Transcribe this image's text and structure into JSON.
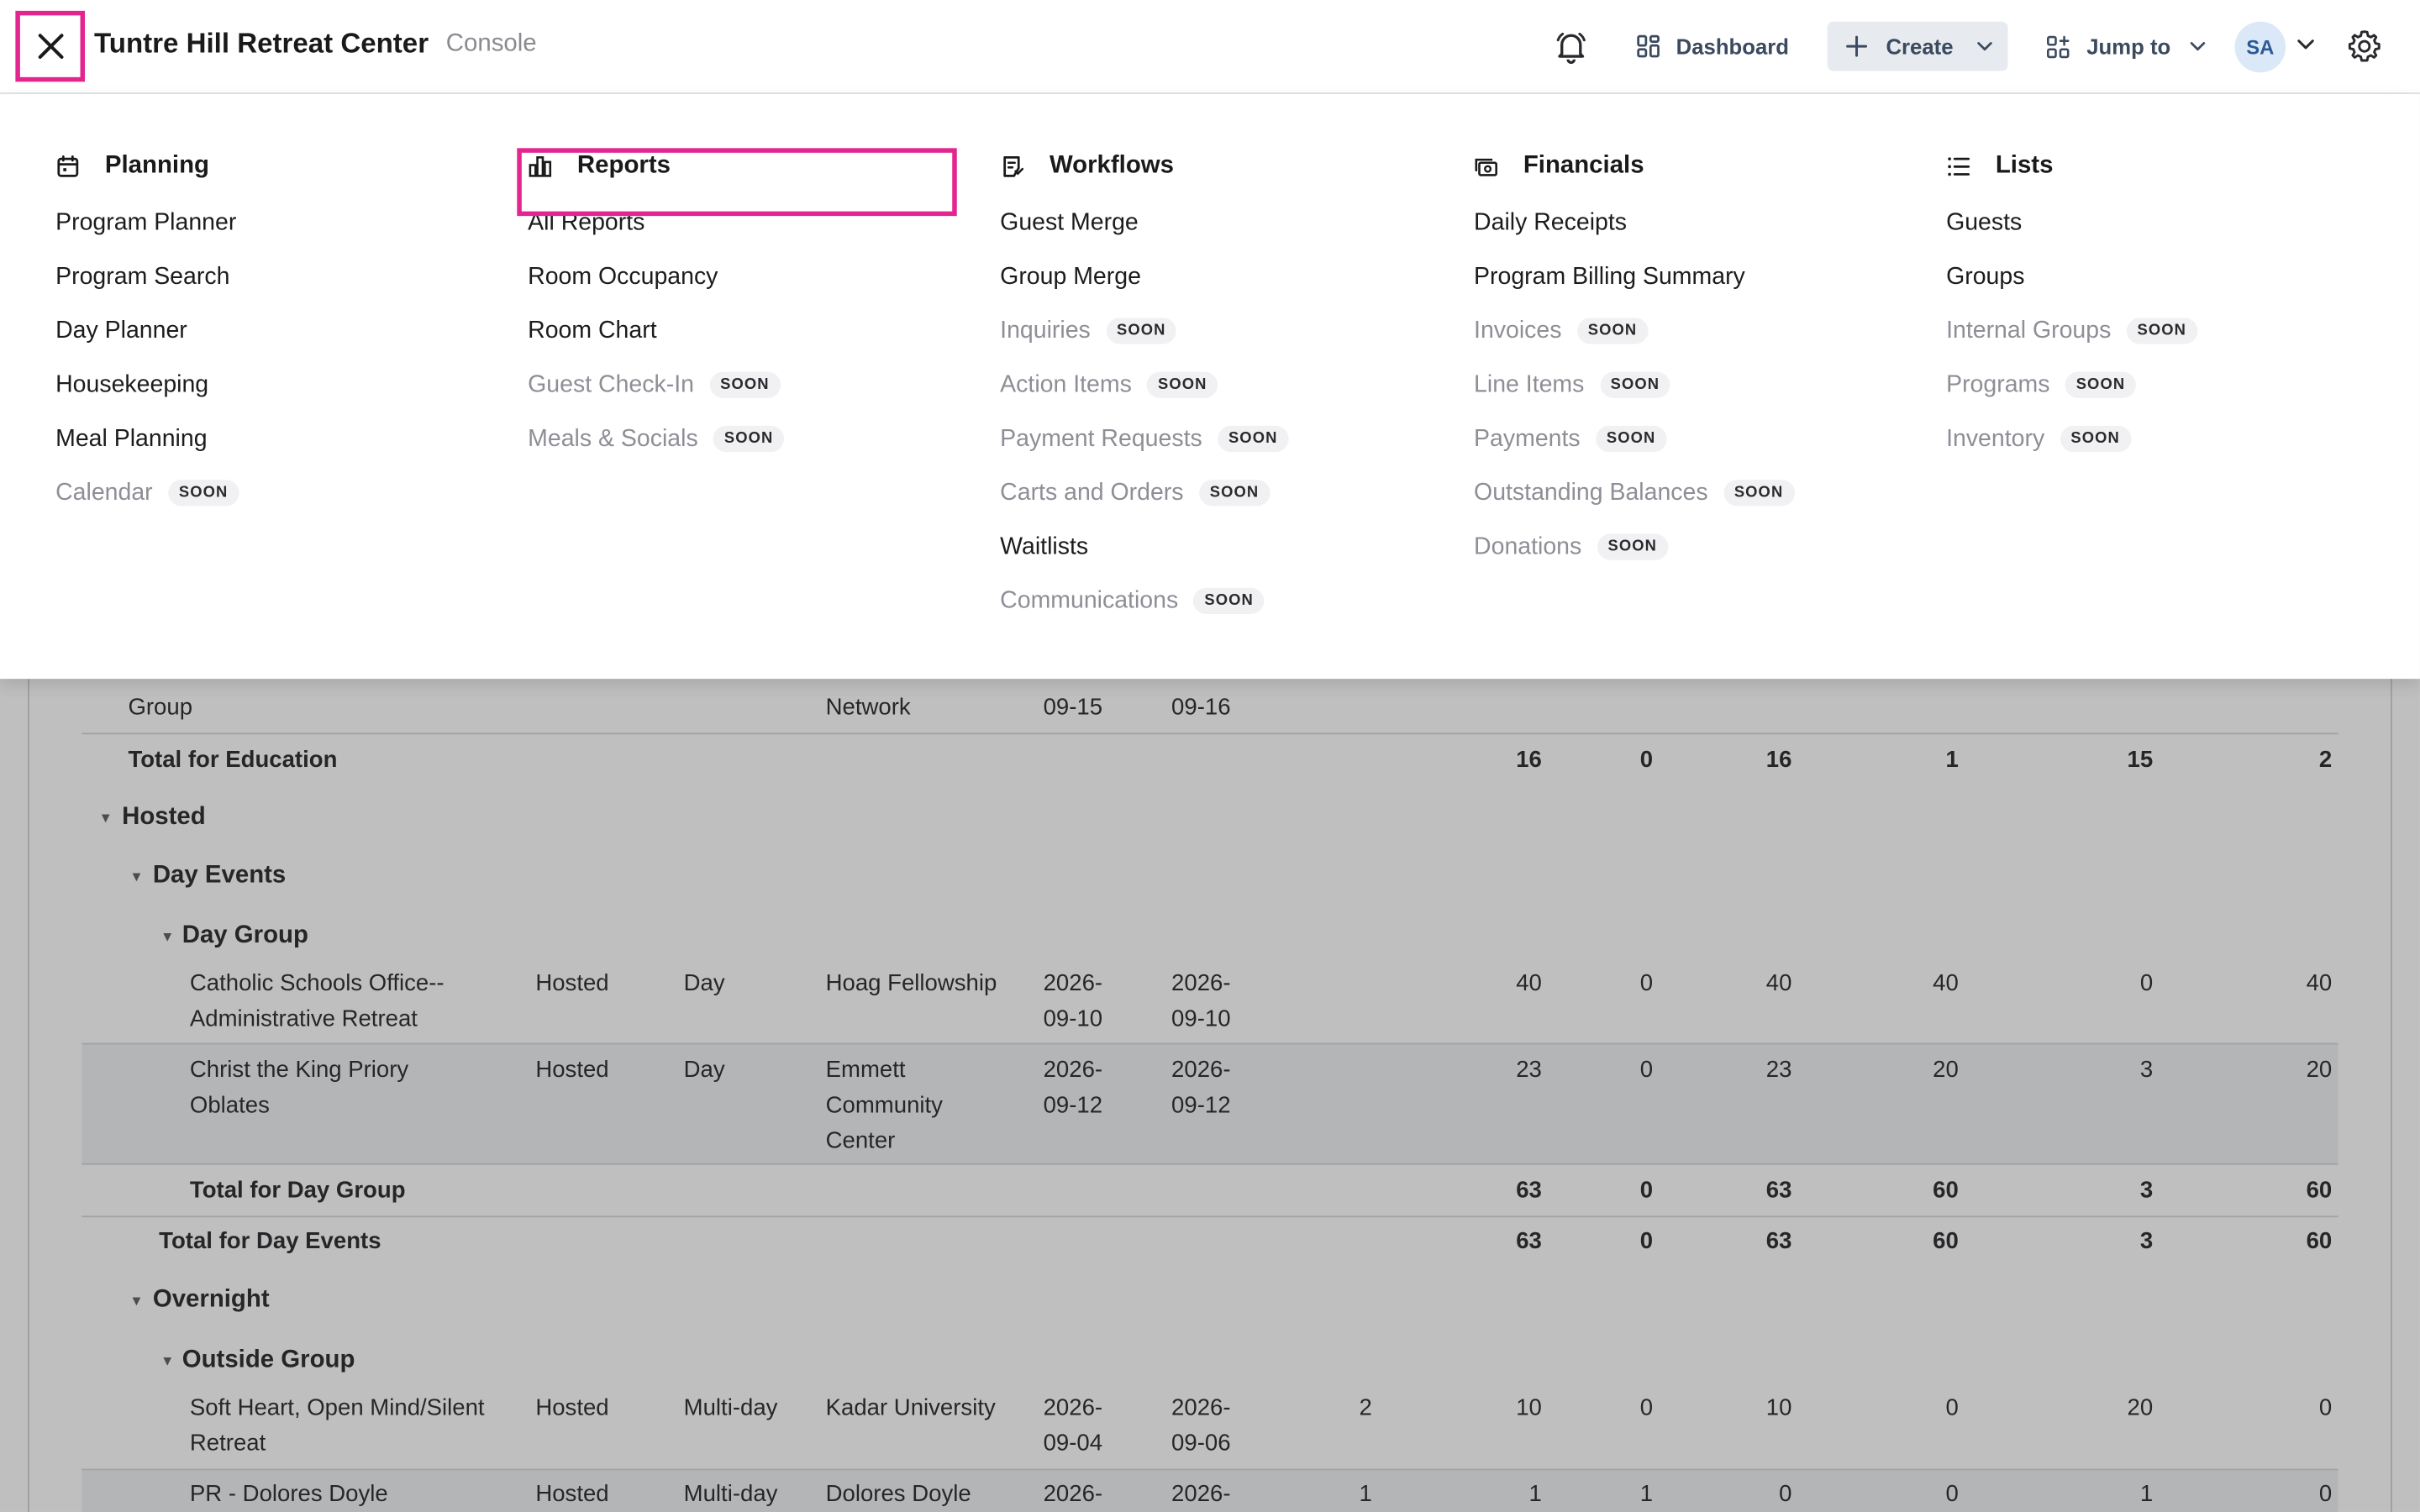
{
  "header": {
    "title": "Tuntre Hill Retreat Center",
    "subtitle": "Console",
    "dashboard_label": "Dashboard",
    "create_label": "Create",
    "jump_label": "Jump to",
    "avatar_initials": "SA"
  },
  "menu": {
    "columns": [
      {
        "heading": "Planning",
        "icon": "calendar-icon",
        "items": [
          {
            "label": "Program Planner",
            "soon": false
          },
          {
            "label": "Program Search",
            "soon": false
          },
          {
            "label": "Day Planner",
            "soon": false
          },
          {
            "label": "Housekeeping",
            "soon": false
          },
          {
            "label": "Meal Planning",
            "soon": false
          },
          {
            "label": "Calendar",
            "soon": true
          }
        ]
      },
      {
        "heading": "Reports",
        "icon": "bar-chart-icon",
        "items": [
          {
            "label": "All Reports",
            "soon": false
          },
          {
            "label": "Room Occupancy",
            "soon": false
          },
          {
            "label": "Room Chart",
            "soon": false
          },
          {
            "label": "Guest Check-In",
            "soon": true
          },
          {
            "label": "Meals & Socials",
            "soon": true
          }
        ]
      },
      {
        "heading": "Workflows",
        "icon": "clipboard-icon",
        "items": [
          {
            "label": "Guest Merge",
            "soon": false
          },
          {
            "label": "Group Merge",
            "soon": false
          },
          {
            "label": "Inquiries",
            "soon": true
          },
          {
            "label": "Action Items",
            "soon": true
          },
          {
            "label": "Payment Requests",
            "soon": true
          },
          {
            "label": "Carts and Orders",
            "soon": true
          },
          {
            "label": "Waitlists",
            "soon": false
          },
          {
            "label": "Communications",
            "soon": true
          }
        ]
      },
      {
        "heading": "Financials",
        "icon": "money-icon",
        "items": [
          {
            "label": "Daily Receipts",
            "soon": false
          },
          {
            "label": "Program Billing Summary",
            "soon": false
          },
          {
            "label": "Invoices",
            "soon": true
          },
          {
            "label": "Line Items",
            "soon": true
          },
          {
            "label": "Payments",
            "soon": true
          },
          {
            "label": "Outstanding Balances",
            "soon": true
          },
          {
            "label": "Donations",
            "soon": true
          }
        ]
      },
      {
        "heading": "Lists",
        "icon": "list-icon",
        "items": [
          {
            "label": "Guests",
            "soon": false
          },
          {
            "label": "Groups",
            "soon": false
          },
          {
            "label": "Internal Groups",
            "soon": true
          },
          {
            "label": "Programs",
            "soon": true
          },
          {
            "label": "Inventory",
            "soon": true
          }
        ]
      }
    ],
    "soon_label": "SOON"
  },
  "report": {
    "partial_row": {
      "name": "Group",
      "org": "Network",
      "start": "09-15",
      "end": "09-16"
    },
    "total_education": {
      "label": "Total for Education",
      "values": [
        "16",
        "0",
        "16",
        "1",
        "15",
        "2"
      ]
    },
    "hosted_label": "Hosted",
    "day_events_label": "Day Events",
    "day_group_label": "Day Group",
    "day_rows": [
      {
        "name": [
          "Catholic Schools Office--",
          "Administrative Retreat"
        ],
        "category": "Hosted",
        "type": "Day",
        "org": [
          "Hoag Fellowship"
        ],
        "start": [
          "2026-",
          "09-10"
        ],
        "end": [
          "2026-",
          "09-10"
        ],
        "nights": "",
        "values": [
          "40",
          "0",
          "40",
          "40",
          "0",
          "40"
        ]
      },
      {
        "name": [
          "Christ the King Priory",
          "Oblates"
        ],
        "category": "Hosted",
        "type": "Day",
        "org": [
          "Emmett",
          "Community",
          "Center"
        ],
        "start": [
          "2026-",
          "09-12"
        ],
        "end": [
          "2026-",
          "09-12"
        ],
        "nights": "",
        "values": [
          "23",
          "0",
          "23",
          "20",
          "3",
          "20"
        ]
      }
    ],
    "total_day_group": {
      "label": "Total for Day Group",
      "values": [
        "63",
        "0",
        "63",
        "60",
        "3",
        "60"
      ]
    },
    "total_day_events": {
      "label": "Total for Day Events",
      "values": [
        "63",
        "0",
        "63",
        "60",
        "3",
        "60"
      ]
    },
    "overnight_label": "Overnight",
    "outside_group_label": "Outside Group",
    "overnight_rows": [
      {
        "name": [
          "Soft Heart, Open Mind/Silent",
          "Retreat"
        ],
        "category": "Hosted",
        "type": "Multi-day",
        "org": [
          "Kadar University"
        ],
        "start": [
          "2026-",
          "09-04"
        ],
        "end": [
          "2026-",
          "09-06"
        ],
        "nights": "2",
        "values": [
          "10",
          "0",
          "10",
          "0",
          "20",
          "0"
        ]
      },
      {
        "name": [
          "PR - Dolores Doyle"
        ],
        "category": "Hosted",
        "type": "Multi-day",
        "org": [
          "Dolores Doyle"
        ],
        "start": [
          "2026-"
        ],
        "end": [
          "2026-"
        ],
        "nights": "1",
        "values": [
          "1",
          "1",
          "0",
          "0",
          "1",
          "0"
        ]
      }
    ]
  }
}
